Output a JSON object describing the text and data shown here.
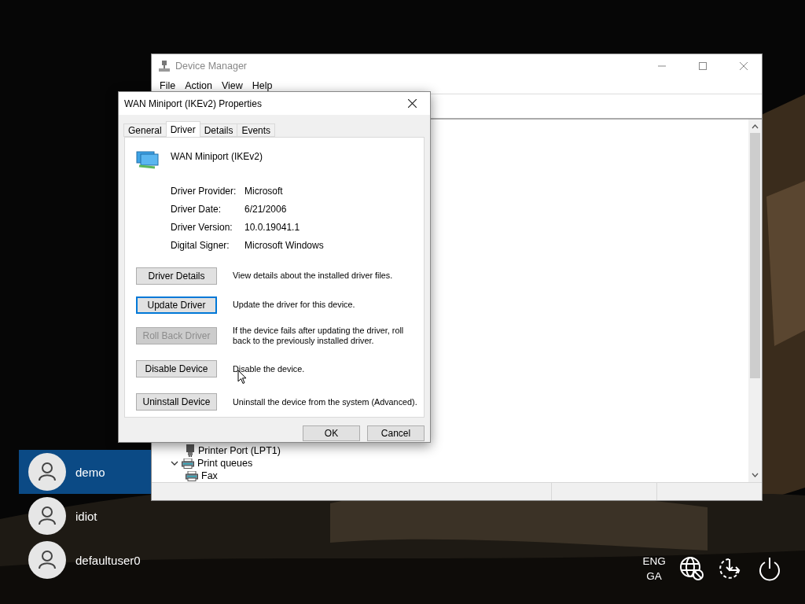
{
  "device_manager": {
    "title": "Device Manager",
    "active": false,
    "menu": [
      "File",
      "Action",
      "View",
      "Help"
    ],
    "tree": [
      {
        "children": [
          {
            "label": "Printer Port (LPT1)",
            "kind": "port"
          }
        ]
      },
      {
        "label": "Print queues",
        "kind": "printer",
        "expanded": true,
        "children": [
          {
            "label": "Fax",
            "kind": "printer"
          }
        ]
      }
    ]
  },
  "dialog": {
    "title": "WAN Miniport (IKEv2) Properties",
    "tabs": [
      {
        "label": "General",
        "selected": false
      },
      {
        "label": "Driver",
        "selected": true
      },
      {
        "label": "Details",
        "selected": false
      },
      {
        "label": "Events",
        "selected": false
      }
    ],
    "device_name": "WAN Miniport (IKEv2)",
    "info": [
      {
        "label": "Driver Provider:",
        "value": "Microsoft"
      },
      {
        "label": "Driver Date:",
        "value": "6/21/2006"
      },
      {
        "label": "Driver Version:",
        "value": "10.0.19041.1"
      },
      {
        "label": "Digital Signer:",
        "value": "Microsoft Windows"
      }
    ],
    "actions": [
      {
        "button": "Driver Details",
        "description": "View details about the installed driver files.",
        "disabled": false,
        "focused": false
      },
      {
        "button": "Update Driver",
        "description": "Update the driver for this device.",
        "disabled": false,
        "focused": true
      },
      {
        "button": "Roll Back Driver",
        "description": "If the device fails after updating the driver, roll back to the previously installed driver.",
        "disabled": true,
        "focused": false
      },
      {
        "button": "Disable Device",
        "description": "Disable the device.",
        "disabled": false,
        "focused": false
      },
      {
        "button": "Uninstall Device",
        "description": "Uninstall the device from the system (Advanced).",
        "disabled": false,
        "focused": false
      }
    ],
    "buttons": [
      "OK",
      "Cancel"
    ]
  },
  "users": [
    {
      "name": "demo",
      "selected": true
    },
    {
      "name": "idiot",
      "selected": false
    },
    {
      "name": "defaultuser0",
      "selected": false
    }
  ],
  "tray": {
    "language": [
      "ENG",
      "GA"
    ]
  }
}
